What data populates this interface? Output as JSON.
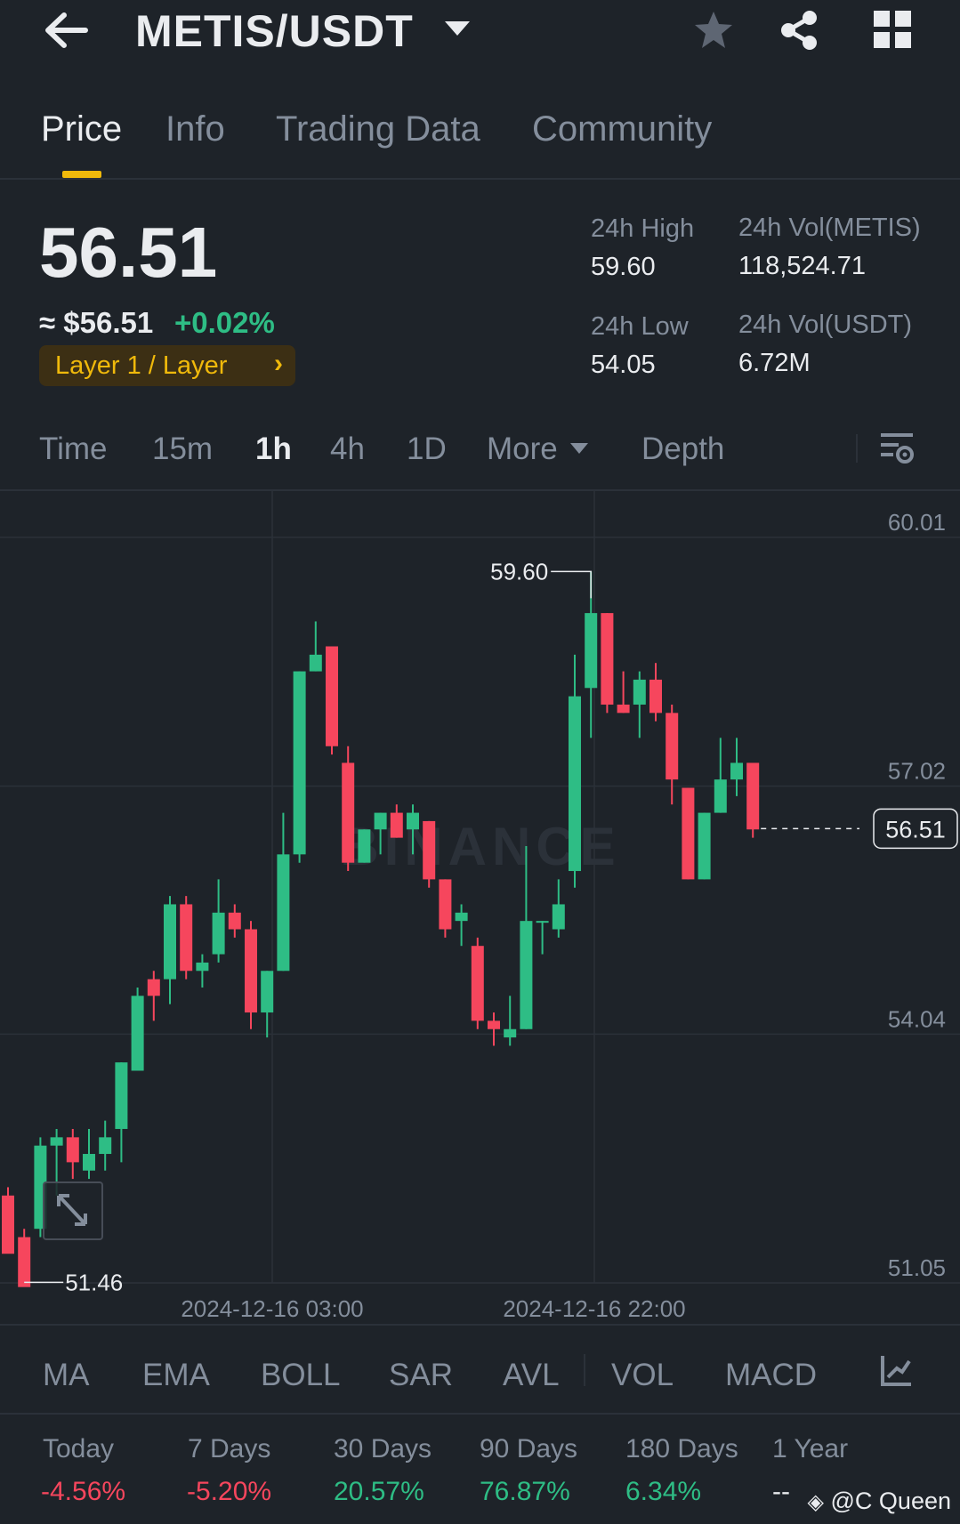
{
  "header": {
    "pair": "METIS/USDT"
  },
  "tabs": [
    {
      "label": "Price",
      "active": true
    },
    {
      "label": "Info",
      "active": false
    },
    {
      "label": "Trading Data",
      "active": false
    },
    {
      "label": "Community",
      "active": false
    }
  ],
  "price": {
    "last": "56.51",
    "approx": "≈ $56.51",
    "change": "+0.02%",
    "tag": "Layer 1 / Layer",
    "high_label": "24h High",
    "high_value": "59.60",
    "low_label": "24h Low",
    "low_value": "54.05",
    "vol_base_label": "24h Vol(METIS)",
    "vol_base_value": "118,524.71",
    "vol_quote_label": "24h Vol(USDT)",
    "vol_quote_value": "6.72M"
  },
  "intervals": [
    "Time",
    "15m",
    "1h",
    "4h",
    "1D",
    "More",
    "Depth"
  ],
  "active_interval": "1h",
  "chart_data": {
    "type": "candlestick",
    "y_ticks": [
      "60.01",
      "57.02",
      "54.04",
      "51.05"
    ],
    "ylim": [
      51.05,
      60.01
    ],
    "x_ticks": [
      "2024-12-16 03:00",
      "2024-12-16 22:00"
    ],
    "max_label": "59.60",
    "min_label": "51.46",
    "current_price_label": "56.51",
    "watermark": "BINANCE",
    "up_color": "#2ebd85",
    "down_color": "#f6465d",
    "candles": [
      {
        "o": 52.1,
        "h": 52.2,
        "l": 51.5,
        "c": 51.4
      },
      {
        "o": 51.6,
        "h": 51.7,
        "l": 51.1,
        "c": 51.0
      },
      {
        "o": 51.7,
        "h": 52.8,
        "l": 51.6,
        "c": 52.7
      },
      {
        "o": 52.7,
        "h": 52.9,
        "l": 52.1,
        "c": 52.8
      },
      {
        "o": 52.8,
        "h": 52.9,
        "l": 52.3,
        "c": 52.5
      },
      {
        "o": 52.4,
        "h": 52.9,
        "l": 52.3,
        "c": 52.6
      },
      {
        "o": 52.6,
        "h": 53.0,
        "l": 52.4,
        "c": 52.8
      },
      {
        "o": 52.9,
        "h": 53.7,
        "l": 52.5,
        "c": 53.7
      },
      {
        "o": 53.6,
        "h": 54.6,
        "l": 53.6,
        "c": 54.5
      },
      {
        "o": 54.7,
        "h": 54.8,
        "l": 54.2,
        "c": 54.5
      },
      {
        "o": 54.7,
        "h": 55.7,
        "l": 54.4,
        "c": 55.6
      },
      {
        "o": 55.6,
        "h": 55.7,
        "l": 54.7,
        "c": 54.8
      },
      {
        "o": 54.8,
        "h": 55.0,
        "l": 54.6,
        "c": 54.9
      },
      {
        "o": 55.0,
        "h": 55.9,
        "l": 54.9,
        "c": 55.5
      },
      {
        "o": 55.5,
        "h": 55.6,
        "l": 55.2,
        "c": 55.3
      },
      {
        "o": 55.3,
        "h": 55.4,
        "l": 54.1,
        "c": 54.3
      },
      {
        "o": 54.3,
        "h": 54.8,
        "l": 54.0,
        "c": 54.8
      },
      {
        "o": 54.8,
        "h": 56.7,
        "l": 54.8,
        "c": 56.2
      },
      {
        "o": 56.2,
        "h": 58.4,
        "l": 56.1,
        "c": 58.4
      },
      {
        "o": 58.4,
        "h": 59.0,
        "l": 58.4,
        "c": 58.6
      },
      {
        "o": 58.7,
        "h": 58.7,
        "l": 57.4,
        "c": 57.5
      },
      {
        "o": 57.3,
        "h": 57.5,
        "l": 56.0,
        "c": 56.1
      },
      {
        "o": 56.1,
        "h": 56.5,
        "l": 56.1,
        "c": 56.5
      },
      {
        "o": 56.5,
        "h": 56.7,
        "l": 56.2,
        "c": 56.7
      },
      {
        "o": 56.7,
        "h": 56.8,
        "l": 56.4,
        "c": 56.4
      },
      {
        "o": 56.5,
        "h": 56.8,
        "l": 56.2,
        "c": 56.7
      },
      {
        "o": 56.6,
        "h": 56.6,
        "l": 55.8,
        "c": 55.9
      },
      {
        "o": 55.9,
        "h": 55.9,
        "l": 55.2,
        "c": 55.3
      },
      {
        "o": 55.4,
        "h": 55.6,
        "l": 55.1,
        "c": 55.5
      },
      {
        "o": 55.1,
        "h": 55.2,
        "l": 54.1,
        "c": 54.2
      },
      {
        "o": 54.2,
        "h": 54.3,
        "l": 53.9,
        "c": 54.1
      },
      {
        "o": 54.0,
        "h": 54.5,
        "l": 53.9,
        "c": 54.1
      },
      {
        "o": 54.1,
        "h": 56.3,
        "l": 54.1,
        "c": 55.4
      },
      {
        "o": 55.4,
        "h": 55.4,
        "l": 55.0,
        "c": 55.4
      },
      {
        "o": 55.3,
        "h": 55.9,
        "l": 55.2,
        "c": 55.6
      },
      {
        "o": 56.0,
        "h": 58.6,
        "l": 55.8,
        "c": 58.1
      },
      {
        "o": 58.2,
        "h": 59.6,
        "l": 57.6,
        "c": 59.1
      },
      {
        "o": 59.1,
        "h": 59.1,
        "l": 57.9,
        "c": 58.0
      },
      {
        "o": 58.0,
        "h": 58.4,
        "l": 57.9,
        "c": 57.9
      },
      {
        "o": 58.0,
        "h": 58.4,
        "l": 57.6,
        "c": 58.3
      },
      {
        "o": 58.3,
        "h": 58.5,
        "l": 57.8,
        "c": 57.9
      },
      {
        "o": 57.9,
        "h": 58.0,
        "l": 56.8,
        "c": 57.1
      },
      {
        "o": 57.0,
        "h": 57.0,
        "l": 55.9,
        "c": 55.9
      },
      {
        "o": 55.9,
        "h": 56.7,
        "l": 55.9,
        "c": 56.7
      },
      {
        "o": 56.7,
        "h": 57.6,
        "l": 56.7,
        "c": 57.1
      },
      {
        "o": 57.1,
        "h": 57.6,
        "l": 56.9,
        "c": 57.3
      },
      {
        "o": 57.3,
        "h": 57.3,
        "l": 56.4,
        "c": 56.5
      }
    ]
  },
  "indicators": [
    "MA",
    "EMA",
    "BOLL",
    "SAR",
    "AVL",
    "VOL",
    "MACD"
  ],
  "performance": [
    {
      "label": "Today",
      "value": "-4.56%",
      "color": "#f6465d"
    },
    {
      "label": "7 Days",
      "value": "-5.20%",
      "color": "#f6465d"
    },
    {
      "label": "30 Days",
      "value": "20.57%",
      "color": "#2ebd85"
    },
    {
      "label": "90 Days",
      "value": "76.87%",
      "color": "#2ebd85"
    },
    {
      "label": "180 Days",
      "value": "6.34%",
      "color": "#2ebd85"
    },
    {
      "label": "1 Year",
      "value": "--",
      "color": "#eaecef"
    }
  ],
  "watermark_user": "@C Queen"
}
